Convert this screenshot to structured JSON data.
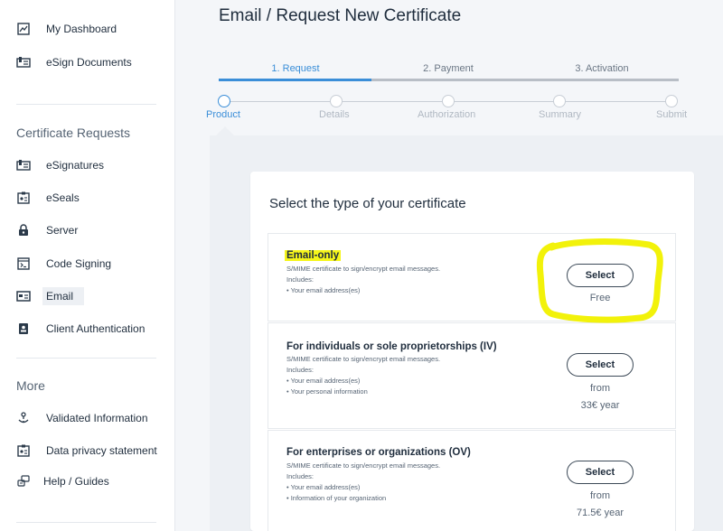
{
  "sidebar": {
    "top_items": [
      {
        "label": "My Dashboard",
        "icon": "dashboard-icon"
      },
      {
        "label": "eSign Documents",
        "icon": "esign-documents-icon"
      }
    ],
    "certificate_requests_title": "Certificate Requests",
    "cert_items": [
      {
        "label": "eSignatures",
        "icon": "esignatures-icon"
      },
      {
        "label": "eSeals",
        "icon": "eseal-icon"
      },
      {
        "label": "Server",
        "icon": "lock-icon"
      },
      {
        "label": "Code Signing",
        "icon": "code-signing-icon"
      },
      {
        "label": "Email",
        "icon": "email-card-icon",
        "active": true
      },
      {
        "label": "Client Authentication",
        "icon": "client-badge-icon"
      }
    ],
    "more_title": "More",
    "more_items": [
      {
        "label": "Validated Information",
        "icon": "validated-icon"
      },
      {
        "label": "Data privacy statement",
        "icon": "privacy-icon"
      },
      {
        "label": "Help / Guides",
        "icon": "help-icon"
      }
    ]
  },
  "page_title": "Email / Request New Certificate",
  "main_steps": [
    {
      "label": "1. Request",
      "active": true
    },
    {
      "label": "2. Payment",
      "active": false
    },
    {
      "label": "3. Activation",
      "active": false
    }
  ],
  "sub_steps": [
    {
      "label": "Product",
      "active": true
    },
    {
      "label": "Details",
      "active": false
    },
    {
      "label": "Authorization",
      "active": false
    },
    {
      "label": "Summary",
      "active": false
    },
    {
      "label": "Submit",
      "active": false
    }
  ],
  "card": {
    "title": "Select the type of your certificate",
    "options": [
      {
        "title": "Email-only",
        "highlighted": true,
        "description": "S/MIME certificate to sign/encrypt email messages.",
        "includes_label": "Includes:",
        "includes": [
          "• Your email address(es)"
        ],
        "button": "Select",
        "price_lines": [
          "Free"
        ]
      },
      {
        "title": "For individuals or sole proprietorships (IV)",
        "highlighted": false,
        "description": "S/MIME certificate to sign/encrypt email messages.",
        "includes_label": "Includes:",
        "includes": [
          "• Your email address(es)",
          "• Your personal information"
        ],
        "button": "Select",
        "price_lines": [
          "from",
          "33€ year"
        ]
      },
      {
        "title": "For enterprises or organizations (OV)",
        "highlighted": false,
        "description": "S/MIME certificate to sign/encrypt email messages.",
        "includes_label": "Includes:",
        "includes": [
          "• Your email address(es)",
          "• Information of your organization"
        ],
        "button": "Select",
        "price_lines": [
          "from",
          "71.5€ year"
        ]
      }
    ]
  },
  "colors": {
    "accent": "#3a8ed8",
    "highlight": "#f5f51a",
    "annotation": "#f2f20a"
  }
}
